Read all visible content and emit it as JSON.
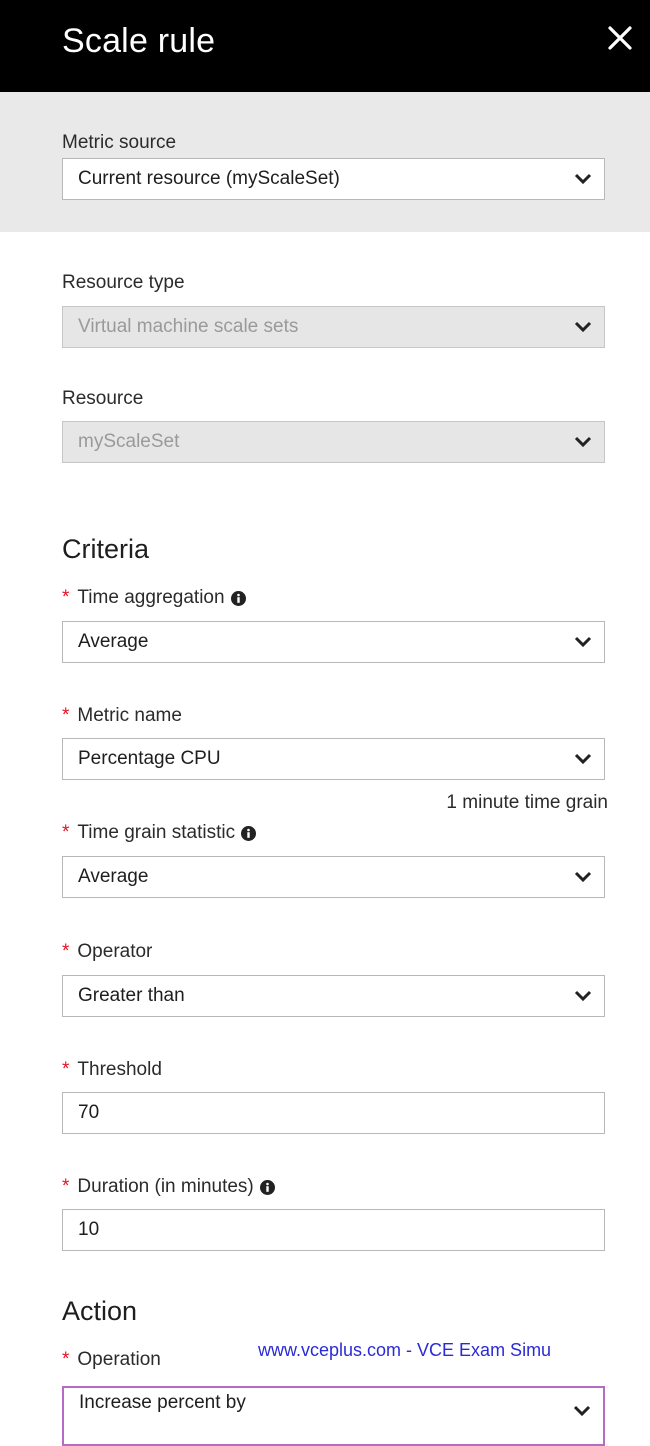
{
  "header": {
    "title": "Scale rule"
  },
  "metric_source": {
    "label": "Metric source",
    "value": "Current resource (myScaleSet)"
  },
  "resource_type": {
    "label": "Resource type",
    "value": "Virtual machine scale sets"
  },
  "resource": {
    "label": "Resource",
    "value": "myScaleSet"
  },
  "criteria": {
    "heading": "Criteria",
    "required_mark": "*",
    "time_aggregation": {
      "label": "Time aggregation",
      "value": "Average"
    },
    "metric_name": {
      "label": "Metric name",
      "value": "Percentage CPU",
      "hint": "1 minute time grain"
    },
    "time_grain_statistic": {
      "label": "Time grain statistic",
      "value": "Average"
    },
    "operator": {
      "label": "Operator",
      "value": "Greater than"
    },
    "threshold": {
      "label": "Threshold",
      "value": "70"
    },
    "duration": {
      "label": "Duration (in minutes)",
      "value": "10"
    }
  },
  "action": {
    "heading": "Action",
    "operation": {
      "label": "Operation",
      "value": "Increase percent by"
    }
  },
  "watermark": "www.vceplus.com - VCE Exam Simu",
  "icons": {
    "close": "close-icon",
    "chevron": "chevron-down-icon",
    "info": "info-icon"
  }
}
